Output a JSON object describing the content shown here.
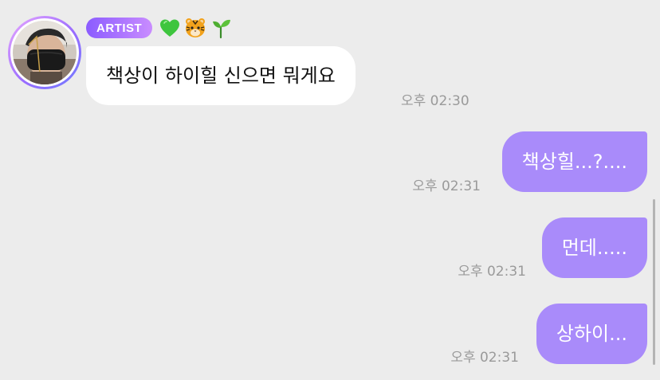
{
  "header": {
    "badge": "ARTIST",
    "emoji_icons": [
      "green-heart-icon",
      "tiger-face-icon",
      "seedling-icon"
    ]
  },
  "messages": [
    {
      "from": "artist",
      "text": "책상이 하이힐 신으면 뭐게요",
      "time": "오후 02:30"
    },
    {
      "from": "me",
      "text": "책상힐...?....",
      "time": "오후 02:31"
    },
    {
      "from": "me",
      "text": "먼데.....",
      "time": "오후 02:31"
    },
    {
      "from": "me",
      "text": "상하이...",
      "time": "오후 02:31"
    }
  ],
  "colors": {
    "background": "#ececec",
    "incoming_bubble": "#ffffff",
    "outgoing_bubble": "#a98bfa",
    "badge_gradient_start": "#8b5cff",
    "badge_gradient_end": "#c98cff",
    "timestamp": "#9a9a9a"
  }
}
